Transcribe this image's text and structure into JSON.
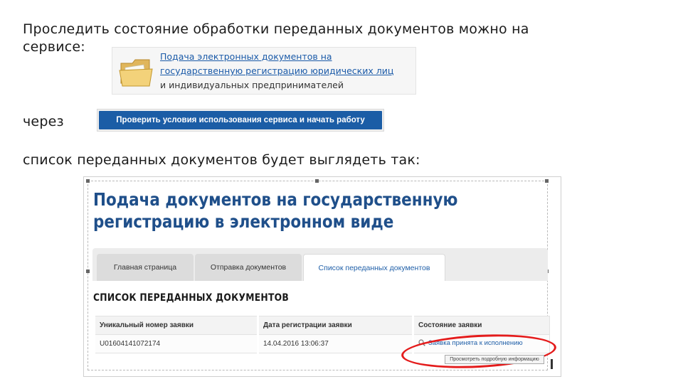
{
  "slide": {
    "intro_line1": "Проследить состояние обработки переданных документов можно на",
    "intro_line2": "сервисе:",
    "via_label": "через",
    "list_caption": "список переданных документов будет выглядеть так:"
  },
  "service_link": {
    "line1": "Подача электронных документов на",
    "line2": "государственную регистрацию юридических лиц",
    "line3": "и индивидуальных предпринимателей"
  },
  "check_button": {
    "label": "Проверить условия использования сервиса и начать работу",
    "color": "#1b5da6"
  },
  "screenshot": {
    "title": "Подача документов на государственную регистрацию в электронном виде",
    "tabs": [
      {
        "label": "Главная страница",
        "active": false
      },
      {
        "label": "Отправка документов",
        "active": false
      },
      {
        "label": "Список переданных документов",
        "active": true
      }
    ],
    "section_title": "СПИСОК ПЕРЕДАННЫХ ДОКУМЕНТОВ",
    "table": {
      "headers": [
        "Уникальный номер заявки",
        "Дата регистрации заявки",
        "Состояние заявки"
      ],
      "rows": [
        [
          "U01604141072174",
          "14.04.2016 13:06:37",
          "Заявка принята к исполнению"
        ]
      ]
    },
    "tooltip": "Просмотреть подробную информацию",
    "highlight_color": "#e41b1b",
    "title_color": "#1f4f8a"
  }
}
